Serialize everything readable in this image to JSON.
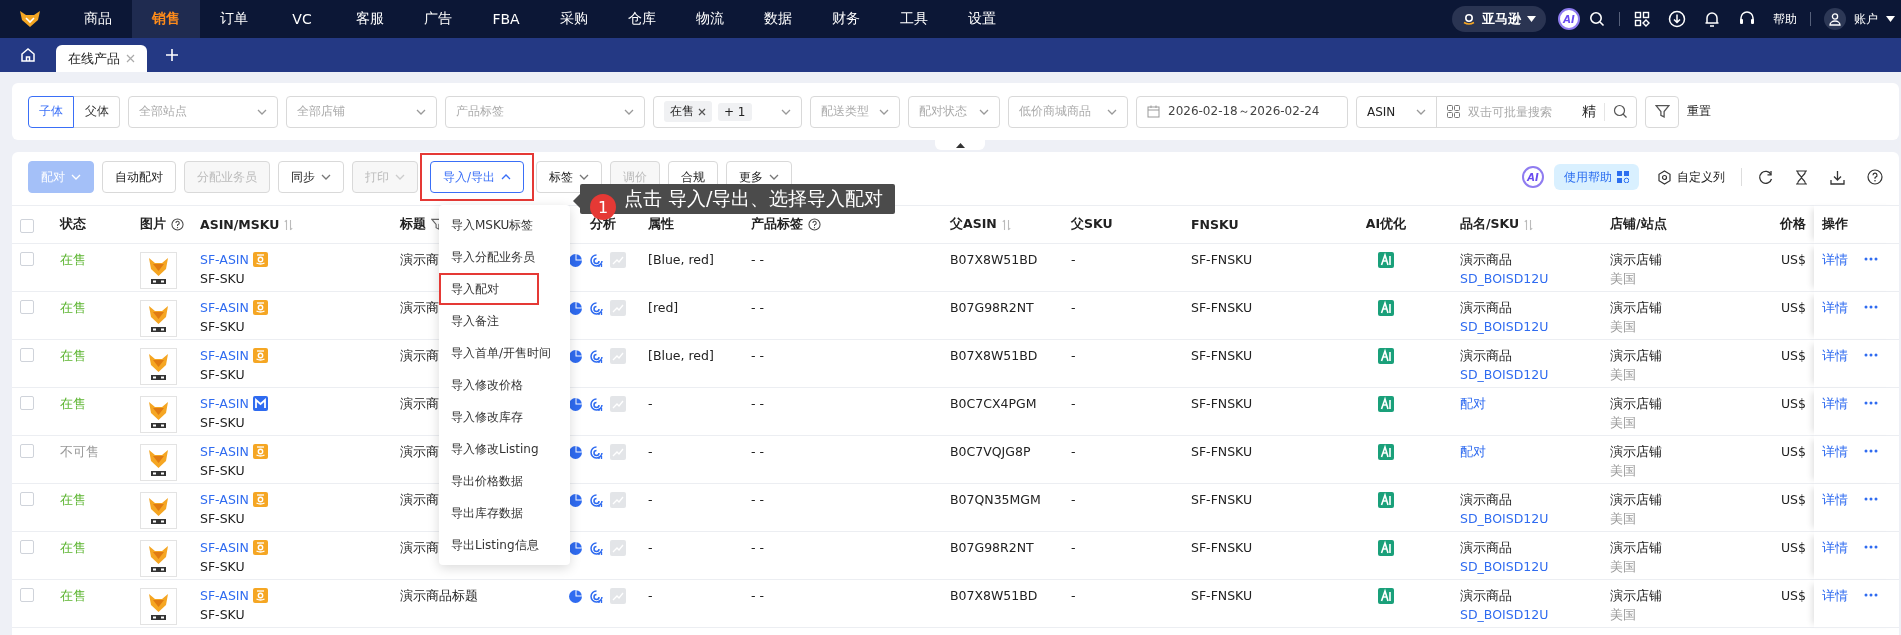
{
  "nav": {
    "items": [
      {
        "label": "商品",
        "selected": false
      },
      {
        "label": "销售",
        "selected": true
      },
      {
        "label": "订单",
        "selected": false
      },
      {
        "label": "VC",
        "selected": false
      },
      {
        "label": "客服",
        "selected": false
      },
      {
        "label": "广告",
        "selected": false
      },
      {
        "label": "FBA",
        "selected": false
      },
      {
        "label": "采购",
        "selected": false
      },
      {
        "label": "仓库",
        "selected": false
      },
      {
        "label": "物流",
        "selected": false
      },
      {
        "label": "数据",
        "selected": false
      },
      {
        "label": "财务",
        "selected": false
      },
      {
        "label": "工具",
        "selected": false
      },
      {
        "label": "设置",
        "selected": false
      }
    ],
    "marketplace": "亚马逊",
    "ai": "AI",
    "help": "帮助",
    "account": "账户"
  },
  "tabs": [
    {
      "label": "在线产品",
      "selected": true
    }
  ],
  "filters": [
    {
      "kind": "segment",
      "options": [
        {
          "label": "子体",
          "selected": true
        },
        {
          "label": "父体",
          "selected": false
        }
      ]
    },
    {
      "kind": "select",
      "placeholder": "全部站点"
    },
    {
      "kind": "select",
      "placeholder": "全部店铺"
    },
    {
      "kind": "select",
      "placeholder": "产品标签"
    },
    {
      "kind": "tags",
      "tags": [
        "在售"
      ],
      "more": "+ 1"
    },
    {
      "kind": "select",
      "placeholder": "配送类型"
    },
    {
      "kind": "select",
      "placeholder": "配对状态"
    },
    {
      "kind": "select",
      "placeholder": "低价商城商品"
    },
    {
      "kind": "date",
      "value": "2026-02-18～2026-02-24"
    },
    {
      "kind": "search",
      "field": "ASIN",
      "placeholder": "双击可批量搜索",
      "exact": "精"
    },
    {
      "kind": "filter_button"
    },
    {
      "kind": "link",
      "label": "重置"
    }
  ],
  "toolbar": {
    "buttons": [
      {
        "label": "配对",
        "kind": "primary",
        "disabled": true,
        "dropdown": true,
        "open": false,
        "highlighted": false
      },
      {
        "label": "自动配对",
        "kind": "default",
        "disabled": false,
        "dropdown": false,
        "open": false,
        "highlighted": false
      },
      {
        "label": "分配业务员",
        "kind": "default",
        "disabled": true,
        "dropdown": false,
        "open": false,
        "highlighted": false
      },
      {
        "label": "同步",
        "kind": "default",
        "disabled": false,
        "dropdown": true,
        "open": false,
        "highlighted": false
      },
      {
        "label": "打印",
        "kind": "default",
        "disabled": true,
        "dropdown": true,
        "open": false,
        "highlighted": false
      },
      {
        "label": "导入/导出",
        "kind": "default",
        "disabled": false,
        "dropdown": true,
        "open": true,
        "highlighted": true
      },
      {
        "label": "标签",
        "kind": "default",
        "disabled": false,
        "dropdown": true,
        "open": false,
        "highlighted": false
      },
      {
        "label": "调价",
        "kind": "default",
        "disabled": true,
        "dropdown": false,
        "open": false,
        "highlighted": false
      },
      {
        "label": "合规",
        "kind": "default",
        "disabled": false,
        "dropdown": false,
        "open": false,
        "highlighted": false
      },
      {
        "label": "更多",
        "kind": "default",
        "disabled": false,
        "dropdown": true,
        "open": false,
        "highlighted": false
      }
    ],
    "ai": "AI",
    "help_button": "使用帮助",
    "columns_button": "自定义列"
  },
  "menu": {
    "items": [
      {
        "label": "导入MSKU标签",
        "highlighted": false
      },
      {
        "label": "导入分配业务员",
        "highlighted": false
      },
      {
        "label": "导入配对",
        "highlighted": true
      },
      {
        "label": "导入备注",
        "highlighted": false
      },
      {
        "label": "导入首单/开售时间",
        "highlighted": false
      },
      {
        "label": "导入修改价格",
        "highlighted": false
      },
      {
        "label": "导入修改库存",
        "highlighted": false
      },
      {
        "label": "导入修改Listing",
        "highlighted": false
      },
      {
        "label": "导出价格数据",
        "highlighted": false
      },
      {
        "label": "导出库存数据",
        "highlighted": false
      },
      {
        "label": "导出Listing信息",
        "highlighted": false
      }
    ]
  },
  "callout": {
    "step": "1",
    "text": "点击 导入/导出、选择导入配对"
  },
  "table": {
    "select_all": {
      "checked": false
    },
    "columns": [
      {
        "label": "状态"
      },
      {
        "label": "图片"
      },
      {
        "label": "ASIN/MSKU"
      },
      {
        "label": "标题"
      },
      {
        "label": "分析"
      },
      {
        "label": "属性"
      },
      {
        "label": "产品标签"
      },
      {
        "label": "父ASIN"
      },
      {
        "label": "父SKU"
      },
      {
        "label": "FNSKU"
      },
      {
        "label": "AI优化"
      },
      {
        "label": "品名/SKU"
      },
      {
        "label": "店铺/站点"
      },
      {
        "label": "价格"
      },
      {
        "label": "操作"
      }
    ],
    "rows": [
      {
        "checked": false,
        "status": "在售",
        "available": true,
        "asin": {
          "text": "SF-ASIN",
          "kind": "amazon"
        },
        "sku": "SF-SKU",
        "title": "演示商",
        "attributes": "[Blue, red]",
        "tags": "- -",
        "parent_asin": "B07X8W51BD",
        "parent_sku": "-",
        "fnsku": "SF-FNSKU",
        "product": {
          "kind": "linked",
          "name": "演示商品",
          "sku": "SD_BOISD12U"
        },
        "shop": "演示店铺",
        "site": "美国",
        "price": "US$",
        "action": "详情"
      },
      {
        "checked": false,
        "status": "在售",
        "available": true,
        "asin": {
          "text": "SF-ASIN",
          "kind": "amazon"
        },
        "sku": "SF-SKU",
        "title": "演示商",
        "attributes": "[red]",
        "tags": "- -",
        "parent_asin": "B07G98R2NT",
        "parent_sku": "-",
        "fnsku": "SF-FNSKU",
        "product": {
          "kind": "linked",
          "name": "演示商品",
          "sku": "SD_BOISD12U"
        },
        "shop": "演示店铺",
        "site": "美国",
        "price": "US$",
        "action": "详情"
      },
      {
        "checked": false,
        "status": "在售",
        "available": true,
        "asin": {
          "text": "SF-ASIN",
          "kind": "amazon"
        },
        "sku": "SF-SKU",
        "title": "演示商",
        "attributes": "[Blue, red]",
        "tags": "- -",
        "parent_asin": "B07X8W51BD",
        "parent_sku": "-",
        "fnsku": "SF-FNSKU",
        "product": {
          "kind": "linked",
          "name": "演示商品",
          "sku": "SD_BOISD12U"
        },
        "shop": "演示店铺",
        "site": "美国",
        "price": "US$",
        "action": "详情"
      },
      {
        "checked": false,
        "status": "在售",
        "available": true,
        "asin": {
          "text": "SF-ASIN",
          "kind": "merchant"
        },
        "sku": "SF-SKU",
        "title": "演示商",
        "attributes": "-",
        "tags": "- -",
        "parent_asin": "B0C7CX4PGM",
        "parent_sku": "-",
        "fnsku": "SF-FNSKU",
        "product": {
          "kind": "unlinked",
          "action": "配对"
        },
        "shop": "演示店铺",
        "site": "美国",
        "price": "US$",
        "action": "详情"
      },
      {
        "checked": false,
        "status": "不可售",
        "available": false,
        "asin": {
          "text": "SF-ASIN",
          "kind": "amazon"
        },
        "sku": "SF-SKU",
        "title": "演示商",
        "attributes": "-",
        "tags": "- -",
        "parent_asin": "B0C7VQJG8P",
        "parent_sku": "-",
        "fnsku": "SF-FNSKU",
        "product": {
          "kind": "unlinked",
          "action": "配对"
        },
        "shop": "演示店铺",
        "site": "美国",
        "price": "US$",
        "action": "详情"
      },
      {
        "checked": false,
        "status": "在售",
        "available": true,
        "asin": {
          "text": "SF-ASIN",
          "kind": "amazon"
        },
        "sku": "SF-SKU",
        "title": "演示商",
        "attributes": "-",
        "tags": "- -",
        "parent_asin": "B07QN35MGM",
        "parent_sku": "-",
        "fnsku": "SF-FNSKU",
        "product": {
          "kind": "linked",
          "name": "演示商品",
          "sku": "SD_BOISD12U"
        },
        "shop": "演示店铺",
        "site": "美国",
        "price": "US$",
        "action": "详情"
      },
      {
        "checked": false,
        "status": "在售",
        "available": true,
        "asin": {
          "text": "SF-ASIN",
          "kind": "amazon"
        },
        "sku": "SF-SKU",
        "title": "演示商",
        "attributes": "-",
        "tags": "- -",
        "parent_asin": "B07G98R2NT",
        "parent_sku": "-",
        "fnsku": "SF-FNSKU",
        "product": {
          "kind": "linked",
          "name": "演示商品",
          "sku": "SD_BOISD12U"
        },
        "shop": "演示店铺",
        "site": "美国",
        "price": "US$",
        "action": "详情"
      },
      {
        "checked": false,
        "status": "在售",
        "available": true,
        "asin": {
          "text": "SF-ASIN",
          "kind": "amazon"
        },
        "sku": "SF-SKU",
        "title": "演示商品标题",
        "attributes": "-",
        "tags": "- -",
        "parent_asin": "B07X8W51BD",
        "parent_sku": "-",
        "fnsku": "SF-FNSKU",
        "product": {
          "kind": "linked",
          "name": "演示商品",
          "sku": "SD_BOISD12U"
        },
        "shop": "演示店铺",
        "site": "美国",
        "price": "US$",
        "action": "详情"
      }
    ]
  }
}
